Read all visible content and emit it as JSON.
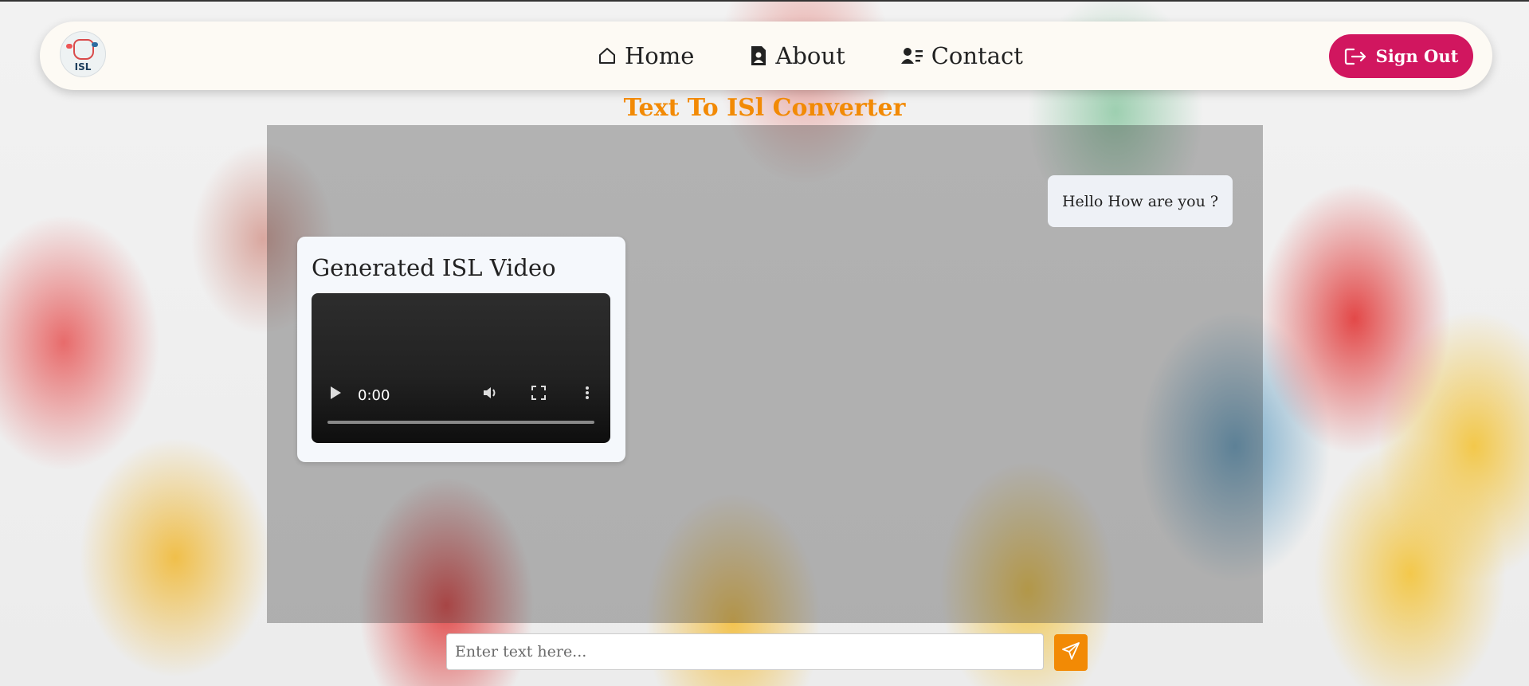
{
  "logo": {
    "text": "ISL"
  },
  "nav": {
    "items": [
      {
        "label": "Home",
        "icon": "home-icon"
      },
      {
        "label": "About",
        "icon": "about-icon"
      },
      {
        "label": "Contact",
        "icon": "contact-icon"
      }
    ],
    "signout_label": "Sign Out"
  },
  "page": {
    "title": "Text To ISl Converter"
  },
  "video_card": {
    "title": "Generated ISL Video",
    "time": "0:00"
  },
  "chat": {
    "message": "Hello How are you ?"
  },
  "composer": {
    "placeholder": "Enter text here...",
    "value": ""
  },
  "colors": {
    "accent_orange": "#f28a05",
    "signout_pink": "#d1165f",
    "navbar_bg": "#fdfaf4"
  }
}
